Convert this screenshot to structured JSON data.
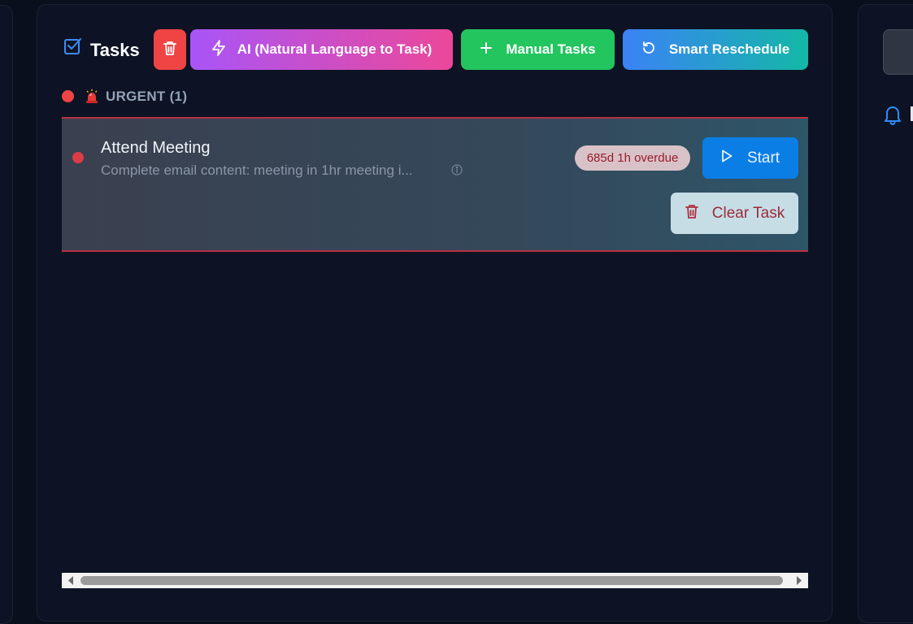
{
  "header": {
    "title": "Tasks",
    "buttons": {
      "ai_label": "AI (Natural Language to Task)",
      "manual_label": "Manual Tasks",
      "reschedule_label": "Smart Reschedule"
    }
  },
  "section": {
    "label": "URGENT (1)"
  },
  "tasks": [
    {
      "title": "Attend Meeting",
      "description": "Complete email content: meeting in 1hr meeting i...",
      "status_badge": "685d 1h overdue",
      "start_label": "Start",
      "clear_label": "Clear Task"
    }
  ],
  "icons": {
    "title": "checkbox-icon",
    "delete": "trash-icon",
    "ai": "lightning-icon",
    "manual": "plus-icon",
    "reschedule": "refresh-icon",
    "urgent": "siren-icon",
    "info": "info-icon",
    "start": "play-icon",
    "clear": "trash-icon",
    "notifications": "bell-icon"
  },
  "colors": {
    "background": "#0a0f1e",
    "panel": "#0d1324",
    "urgent_red": "#ef4444",
    "ai_gradient": [
      "#a855f7",
      "#ec4899"
    ],
    "manual_green": "#22c55e",
    "reschedule_gradient": [
      "#3b82f6",
      "#14b8a6"
    ],
    "start_blue": "#0b7ee6"
  }
}
